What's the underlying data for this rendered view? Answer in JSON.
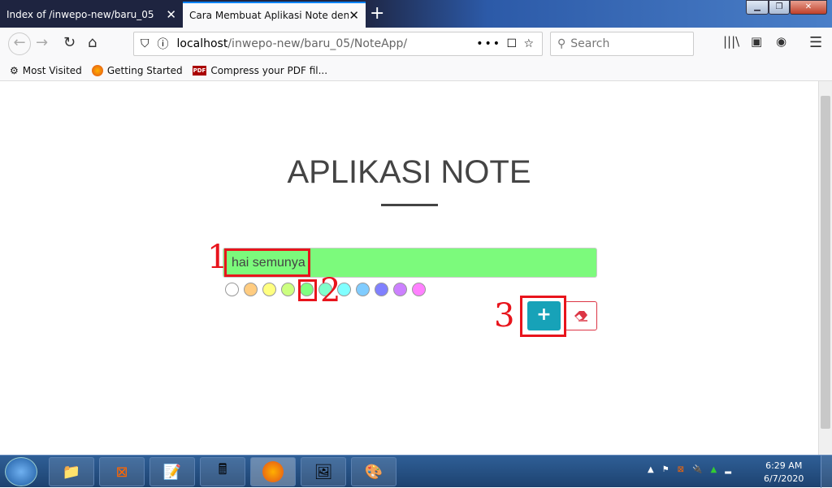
{
  "browser": {
    "tabs": [
      {
        "label": "Index of /inwepo-new/baru_05"
      },
      {
        "label": "Cara Membuat Aplikasi Note dengan"
      }
    ],
    "url_host": "localhost",
    "url_path": "/inwepo-new/baru_05/NoteApp/",
    "search_placeholder": "Search",
    "bookmarks": [
      {
        "label": "Most Visited"
      },
      {
        "label": "Getting Started"
      },
      {
        "label": "Compress your PDF fil..."
      }
    ]
  },
  "page": {
    "title": "APLIKASI NOTE",
    "note_value": "hai semunya",
    "colors": [
      "#ffffff",
      "#ffcc80",
      "#ffff80",
      "#ccff80",
      "#80ff80",
      "#80ffcc",
      "#80ffff",
      "#80ccff",
      "#8080ff",
      "#cc80ff",
      "#ff80ff"
    ],
    "selected_color": "#80ff80",
    "add_label": "+"
  },
  "annotations": [
    "1",
    "2",
    "3"
  ],
  "taskbar": {
    "time": "6:29 AM",
    "date": "6/7/2020"
  }
}
